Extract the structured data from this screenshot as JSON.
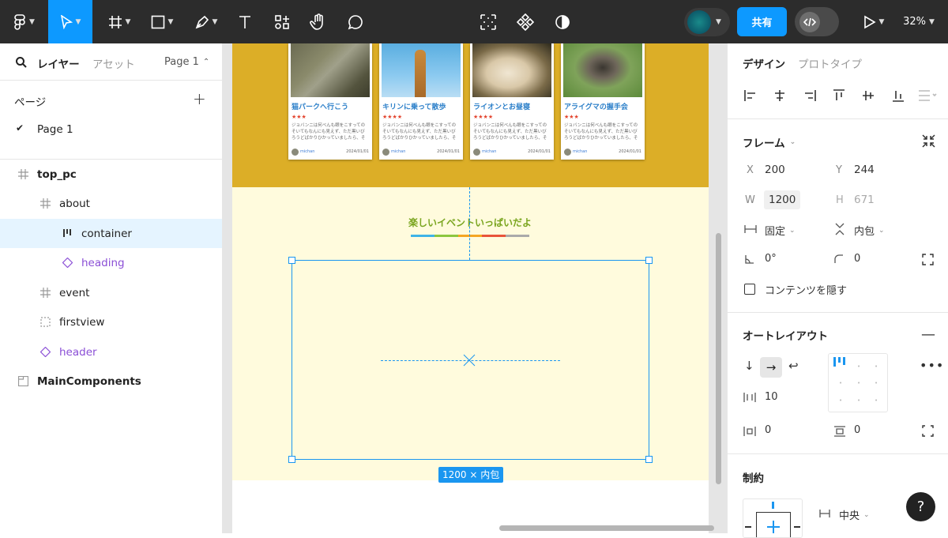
{
  "toolbar": {
    "share_label": "共有",
    "zoom": "32%"
  },
  "left_panel": {
    "tabs": {
      "layers": "レイヤー",
      "assets": "アセット"
    },
    "page_selector": "Page 1",
    "pages_title": "ページ",
    "pages": [
      {
        "label": "Page 1",
        "selected": true
      }
    ],
    "layers": [
      {
        "label": "top_pc",
        "bold": true,
        "icon": "frame-icon"
      },
      {
        "label": "about",
        "icon": "frame-icon"
      },
      {
        "label": "container",
        "icon": "autolayout-icon",
        "selected": true
      },
      {
        "label": "heading",
        "icon": "instance-icon",
        "purple": true
      },
      {
        "label": "event",
        "icon": "frame-icon"
      },
      {
        "label": "firstview",
        "icon": "dashed-frame-icon"
      },
      {
        "label": "header",
        "icon": "instance-icon",
        "purple": true
      },
      {
        "label": "MainComponents",
        "bold": true,
        "icon": "section-icon"
      }
    ]
  },
  "canvas": {
    "cards": [
      {
        "title": "猫パークへ行こう",
        "stars": "★★★",
        "text": "ジョバンニは何べんも眼をこすってのそいてもなんにも見えず、ただ黒いびろうどばかりひかっていましたら、そのな…",
        "user": "michan",
        "date": "2024/01/01"
      },
      {
        "title": "キリンに乗って散歩",
        "stars": "★★★★",
        "text": "ジョバンニは何べんも眼をこすってのそいてもなんにも見えず、ただ黒いびろうどばかりひかっていましたら、そのな…",
        "user": "michan",
        "date": "2024/01/01"
      },
      {
        "title": "ライオンとお昼寝",
        "stars": "★★★★",
        "text": "ジョバンニは何べんも眼をこすってのそいてもなんにも見えず、ただ黒いびろうどばかりひかっていましたら、そのな…",
        "user": "michan",
        "date": "2024/01/01"
      },
      {
        "title": "アライグマの握手会",
        "stars": "★★★",
        "text": "ジョバンニは何べんも眼をこすってのそいてもなんにも見えず、ただ黒いびろうどばかりひかっていましたら、そのな…",
        "user": "michan",
        "date": "2024/01/01"
      }
    ],
    "heading": "楽しいイベントいっぱいだよ",
    "size_badge": "1200 × 内包"
  },
  "right_panel": {
    "tabs": {
      "design": "デザイン",
      "prototype": "プロトタイプ"
    },
    "frame": {
      "title": "フレーム",
      "x_label": "X",
      "x": "200",
      "y_label": "Y",
      "y": "244",
      "w_label": "W",
      "w": "1200",
      "h_label": "H",
      "h": "671",
      "width_mode": "固定",
      "height_mode": "内包",
      "rotation": "0°",
      "radius": "0",
      "clip_label": "コンテンツを隠す"
    },
    "autolayout": {
      "title": "オートレイアウト",
      "gap": "10",
      "padding_h": "0",
      "padding_v": "0"
    },
    "constraints": {
      "title": "制約",
      "horizontal": "中央"
    }
  },
  "colors": {
    "accent": "#0d99ff",
    "toolbar": "#2c2c2c",
    "selection": "#1a96f0",
    "event_bg": "#dcae27",
    "about_bg": "#fffbdd",
    "heading_text": "#7aa51f"
  }
}
